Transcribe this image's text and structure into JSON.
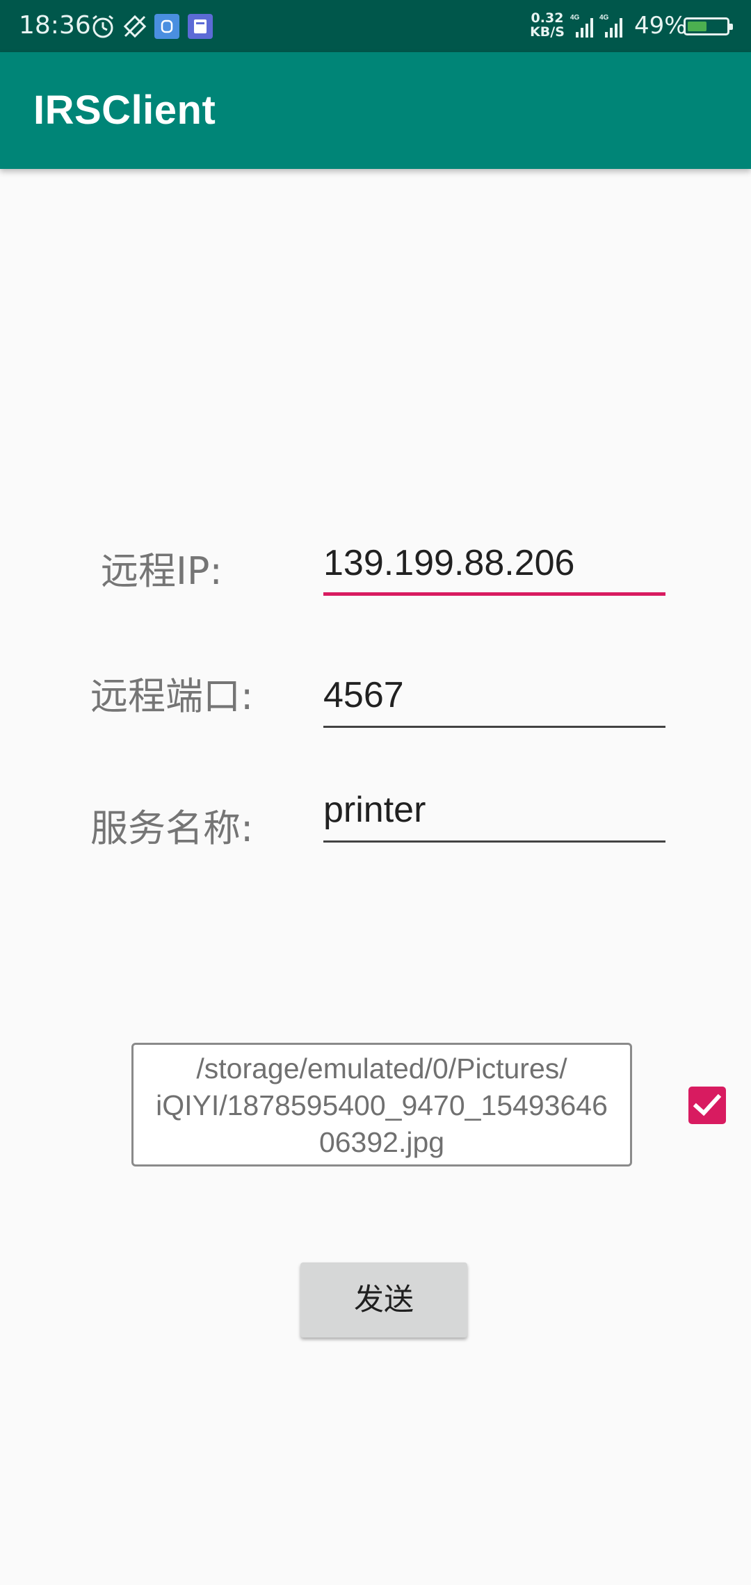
{
  "status_bar": {
    "time": "18:36",
    "net_speed_value": "0.32",
    "net_speed_unit": "KB/S",
    "network_1": "4G",
    "network_2": "4G",
    "battery_percent": "49%",
    "icons": [
      "alarm-icon",
      "rotate-icon",
      "app-notification-icon",
      "calendar-notification-icon",
      "signal-icon",
      "signal-icon",
      "battery-icon"
    ]
  },
  "app_bar": {
    "title": "IRSClient",
    "color": "#008577"
  },
  "form": {
    "ip_label": "远程IP:",
    "ip_value": "139.199.88.206",
    "port_label": "远程端口:",
    "port_value": "4567",
    "service_label": "服务名称:",
    "service_value": "printer"
  },
  "file": {
    "path_lines": [
      "/storage/emulated/0/Pictures/",
      "iQIYI/1878595400_9470_15493646",
      "06392.jpg"
    ],
    "checked": true
  },
  "send_button": {
    "label": "发送"
  },
  "colors": {
    "accent": "#d81b60",
    "primary": "#008577",
    "primary_dark": "#00574b"
  }
}
